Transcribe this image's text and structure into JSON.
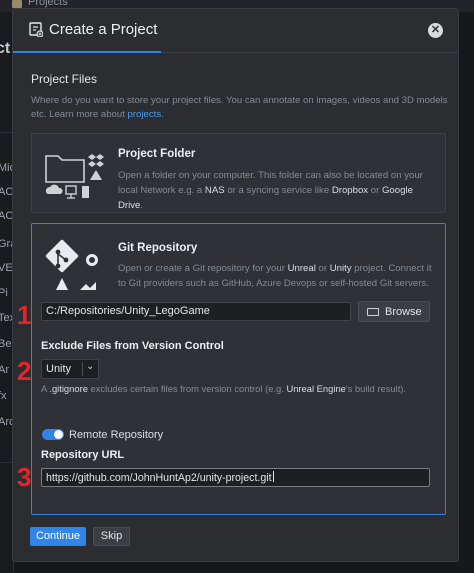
{
  "background": {
    "breadcrumb": "Projects",
    "side_heading": "ct",
    "side_items": [
      "Mic",
      "AC",
      "AC",
      "Gra",
      "VE",
      "Pi",
      "Tex",
      "Be",
      "Ar",
      "fx",
      "Arc"
    ]
  },
  "dialog": {
    "title": "Create a Project",
    "close_label": "✕"
  },
  "project_files": {
    "title": "Project Files",
    "desc_prefix": "Where do you want to store your project files. You can annotate on images, videos and 3D models etc. Learn more about ",
    "desc_link": "projects",
    "desc_suffix": "."
  },
  "project_folder": {
    "title": "Project Folder",
    "desc_1": "Open a folder on your computer. This folder can also be located on your local Network e.g. a ",
    "desc_nas": "NAS",
    "desc_2": " or a syncing service like ",
    "desc_dropbox": "Dropbox",
    "desc_3": " or ",
    "desc_gdrive": "Google Drive",
    "desc_4": "."
  },
  "git_repository": {
    "title": "Git Repository",
    "desc_1": "Open or create a Git repository for your ",
    "desc_unreal": "Unreal",
    "desc_2": " or ",
    "desc_unity": "Unity",
    "desc_3": " project. Connect it to Git providers such as GitHub, Azure Devops or self-hosted Git servers.",
    "path_value": "C:/Repositories/Unity_LegoGame",
    "browse_label": "Browse",
    "exclude_title": "Exclude Files from Version Control",
    "exclude_selected": "Unity",
    "ignore_prefix": "A ",
    "ignore_name": ".gitignore",
    "ignore_mid": " excludes certain files from version control (e.g. ",
    "ignore_engine": "Unreal Engine",
    "ignore_suffix": "'s build result).",
    "remote_toggle_label": "Remote Repository",
    "remote_enabled": true,
    "url_title": "Repository URL",
    "url_value": "https://github.com/JohnHuntAp2/unity-project.git"
  },
  "actions": {
    "continue_label": "Continue",
    "skip_label": "Skip"
  },
  "annotations": [
    "1",
    "2",
    "3"
  ],
  "colors": {
    "accent": "#2f86e8",
    "annotation": "#e8242a",
    "dialog_bg": "#2b2d31"
  }
}
